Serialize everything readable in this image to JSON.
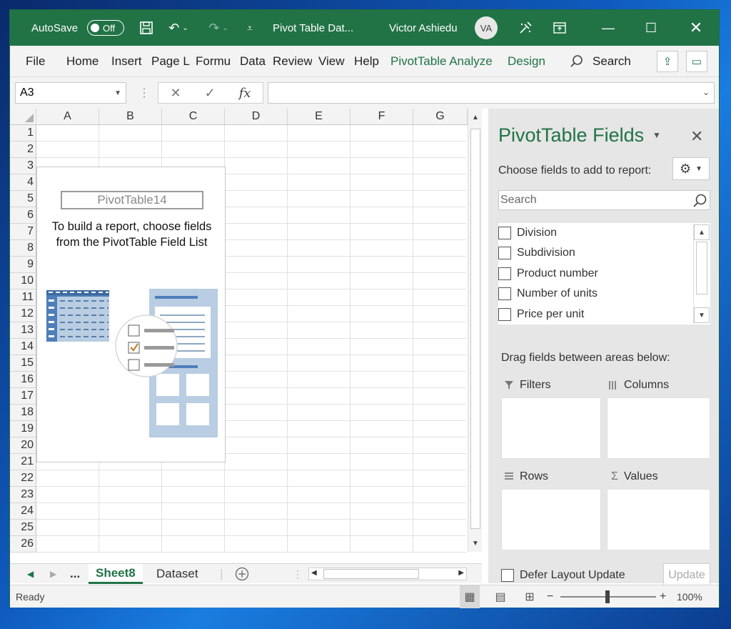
{
  "title_bar": {
    "autosave_label": "AutoSave",
    "autosave_state": "Off",
    "document_title": "Pivot Table Dat...",
    "user_name": "Victor Ashiedu",
    "user_initials": "VA"
  },
  "ribbon": {
    "tabs": [
      "File",
      "Home",
      "Insert",
      "Page L",
      "Formu",
      "Data",
      "Review",
      "View",
      "Help",
      "PivotTable Analyze",
      "Design"
    ],
    "search_label": "Search"
  },
  "formula_bar": {
    "name_box": "A3",
    "fx_label": "fx",
    "formula_value": ""
  },
  "grid": {
    "columns": [
      "A",
      "B",
      "C",
      "D",
      "E",
      "F",
      "G"
    ],
    "rows": [
      "1",
      "2",
      "3",
      "4",
      "5",
      "6",
      "7",
      "8",
      "9",
      "10",
      "11",
      "12",
      "13",
      "14",
      "15",
      "16",
      "17",
      "18",
      "19",
      "20",
      "21",
      "22",
      "23",
      "24",
      "25",
      "26"
    ],
    "selected_cell": "A3"
  },
  "pivot_placeholder": {
    "name": "PivotTable14",
    "instruction_line1": "To build a report, choose fields",
    "instruction_line2": "from the PivotTable Field List"
  },
  "sheet_tabs": {
    "ellipsis": "...",
    "tabs": [
      "Sheet8",
      "Dataset"
    ],
    "active": "Sheet8"
  },
  "field_pane": {
    "title": "PivotTable Fields",
    "subtitle": "Choose fields to add to report:",
    "search_placeholder": "Search",
    "fields": [
      "Division",
      "Subdivision",
      "Product number",
      "Number of units",
      "Price per unit"
    ],
    "drag_label": "Drag fields between areas below:",
    "areas": {
      "filters": "Filters",
      "columns": "Columns",
      "rows": "Rows",
      "values": "Values"
    },
    "defer_label": "Defer Layout Update",
    "update_label": "Update"
  },
  "status_bar": {
    "status": "Ready",
    "zoom": "100%",
    "zoom_level": 100
  },
  "colors": {
    "accent": "#217346",
    "pivot_icon_blue": "#4f7fb8"
  }
}
